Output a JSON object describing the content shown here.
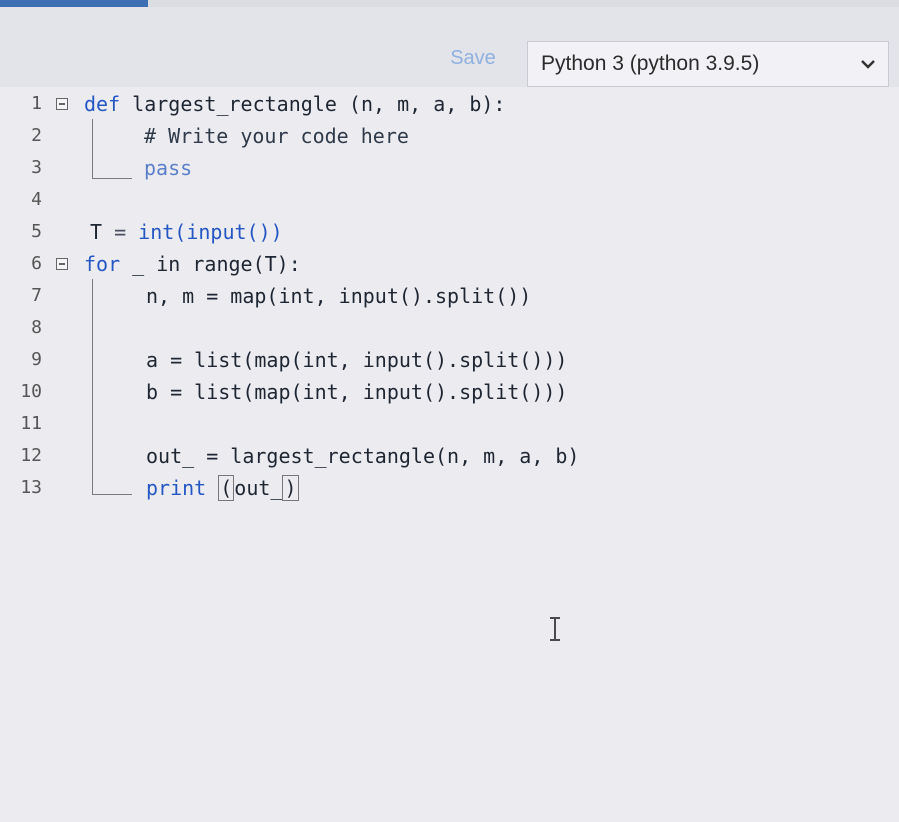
{
  "toolbar": {
    "save_label": "Save",
    "language_label": "Python 3 (python 3.9.5)"
  },
  "editor": {
    "line_numbers": [
      "1",
      "2",
      "3",
      "4",
      "5",
      "6",
      "7",
      "8",
      "9",
      "10",
      "11",
      "12",
      "13"
    ],
    "code": {
      "l1_def": "def",
      "l1_rest": " largest_rectangle (n, m, a, b):",
      "l2": "# Write your code here",
      "l3": "pass",
      "l5_T": "T",
      "l5_eq": " = ",
      "l5_rest": "int(input())",
      "l6_for": "for",
      "l6_rest": " _ in range(T):",
      "l7": "n, m = map(int, input().split())",
      "l9": "a = list(map(int, input().split()))",
      "l10": "b = list(map(int, input().split()))",
      "l12": "out_ = largest_rectangle(n, m, a, b)",
      "l13_print": "print ",
      "l13_open": "(",
      "l13_arg": "out_",
      "l13_close": ")"
    }
  },
  "colors": {
    "keyword": "#2457c4",
    "accent": "#3e6fb5",
    "background": "#ececf0"
  },
  "icons": {
    "dropdown": "chevron-down-icon",
    "fold": "fold-collapse-icon",
    "cursor": "text-cursor-icon"
  }
}
